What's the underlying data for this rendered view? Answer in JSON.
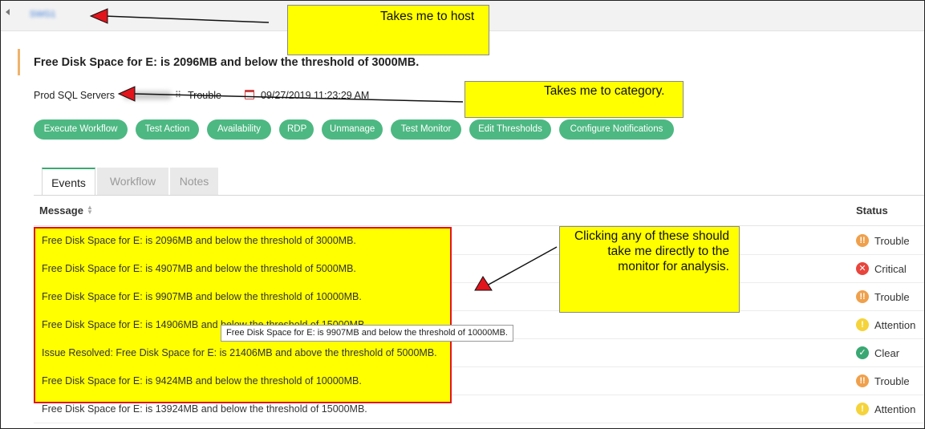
{
  "header": {
    "host_link": "SWG1"
  },
  "alarm": {
    "title": "Free Disk Space for E: is 2096MB and below the threshold of 3000MB.",
    "category": "Prod SQL Servers",
    "status": "Trouble",
    "timestamp": "09/27/2019 11:23:29 AM"
  },
  "actions": [
    "Execute Workflow",
    "Test Action",
    "Availability",
    "RDP",
    "Unmanage",
    "Test Monitor",
    "Edit Thresholds",
    "Configure Notifications"
  ],
  "tabs": [
    {
      "label": "Events",
      "active": true
    },
    {
      "label": "Workflow",
      "active": false
    },
    {
      "label": "Notes",
      "active": false
    }
  ],
  "table": {
    "columns": {
      "message": "Message",
      "status": "Status"
    },
    "rows": [
      {
        "message": "Free Disk Space for E: is 2096MB and below the threshold of 3000MB.",
        "status": "Trouble",
        "icon": "trouble-icon"
      },
      {
        "message": "Free Disk Space for E: is 4907MB and below the threshold of 5000MB.",
        "status": "Critical",
        "icon": "critical-icon"
      },
      {
        "message": "Free Disk Space for E: is 9907MB and below the threshold of 10000MB.",
        "status": "Trouble",
        "icon": "trouble-icon"
      },
      {
        "message": "Free Disk Space for E: is 14906MB and below the threshold of 15000MB.",
        "status": "Attention",
        "icon": "attention-icon"
      },
      {
        "message": "Issue Resolved: Free Disk Space for E: is 21406MB and above the threshold of 5000MB.",
        "status": "Clear",
        "icon": "clear-icon"
      },
      {
        "message": "Free Disk Space for E: is 9424MB and below the threshold of 10000MB.",
        "status": "Trouble",
        "icon": "trouble-icon"
      },
      {
        "message": "Free Disk Space for E: is 13924MB and below the threshold of 15000MB.",
        "status": "Attention",
        "icon": "attention-icon"
      }
    ]
  },
  "tooltip": "Free Disk Space for E: is 9907MB and below the threshold of 10000MB.",
  "annotations": {
    "host_note": "Takes me to host",
    "category_note": "Takes me to category.",
    "monitor_note": [
      "Clicking any of these should",
      "take me directly to the",
      "monitor for analysis."
    ]
  },
  "colors": {
    "button": "#4db882",
    "trouble": "#f0a04b",
    "critical": "#e8453c",
    "attention": "#f5d33a",
    "clear": "#3aa873",
    "highlight": "#ffff00",
    "highlight_border": "#e2141c"
  }
}
